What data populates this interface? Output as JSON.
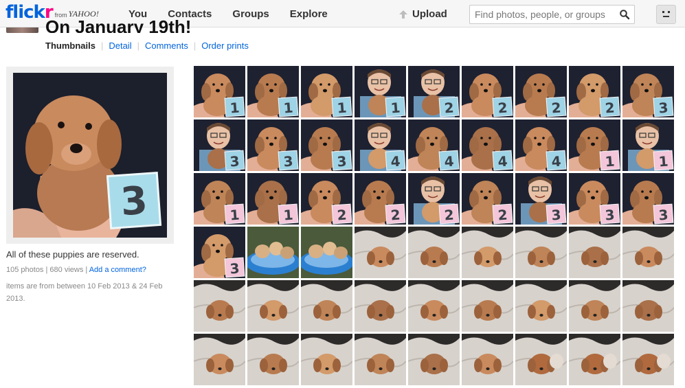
{
  "nav": {
    "logo_part1": "flick",
    "logo_part2": "r",
    "from_label": "from",
    "yahoo_label": "YAHOO!",
    "links": [
      "You",
      "Contacts",
      "Groups",
      "Explore"
    ],
    "upload_label": "Upload",
    "search_placeholder": "Find photos, people, or groups"
  },
  "set": {
    "title": "On January 19th!",
    "tabs": [
      "Thumbnails",
      "Detail",
      "Comments",
      "Order prints"
    ],
    "active_tab": "Thumbnails",
    "description": "All of these puppies are reserved.",
    "photo_count": "105 photos",
    "views": "680 views",
    "comment_link": "Add a comment?",
    "date_range": "items are from between 10 Feb 2013 & 24 Feb 2013.",
    "cover_card_number": "3"
  },
  "grid": {
    "rows": [
      [
        {
          "scene": "hand",
          "card": "1",
          "cardColor": "#9fd3e6"
        },
        {
          "scene": "hand",
          "card": "1",
          "cardColor": "#9fd3e6"
        },
        {
          "scene": "hand",
          "card": "1",
          "cardColor": "#9fd3e6"
        },
        {
          "scene": "boy",
          "card": "1",
          "cardColor": "#9fd3e6"
        },
        {
          "scene": "boy",
          "card": "2",
          "cardColor": "#9fd3e6"
        },
        {
          "scene": "hand",
          "card": "2",
          "cardColor": "#9fd3e6"
        },
        {
          "scene": "hand",
          "card": "2",
          "cardColor": "#9fd3e6"
        },
        {
          "scene": "hand",
          "card": "2",
          "cardColor": "#9fd3e6"
        },
        {
          "scene": "hand",
          "card": "3",
          "cardColor": "#9fd3e6"
        }
      ],
      [
        {
          "scene": "boy",
          "card": "3",
          "cardColor": "#9fd3e6"
        },
        {
          "scene": "hand",
          "card": "3",
          "cardColor": "#9fd3e6"
        },
        {
          "scene": "hand",
          "card": "3",
          "cardColor": "#9fd3e6"
        },
        {
          "scene": "boy",
          "card": "4",
          "cardColor": "#9fd3e6"
        },
        {
          "scene": "hand",
          "card": "4",
          "cardColor": "#9fd3e6"
        },
        {
          "scene": "hand",
          "card": "4",
          "cardColor": "#9fd3e6"
        },
        {
          "scene": "hand",
          "card": "4",
          "cardColor": "#9fd3e6"
        },
        {
          "scene": "hand",
          "card": "1",
          "cardColor": "#f3c6da"
        },
        {
          "scene": "boy",
          "card": "1",
          "cardColor": "#f3c6da"
        }
      ],
      [
        {
          "scene": "hand",
          "card": "1",
          "cardColor": "#f3c6da"
        },
        {
          "scene": "hand",
          "card": "1",
          "cardColor": "#f3c6da"
        },
        {
          "scene": "hand",
          "card": "2",
          "cardColor": "#f3c6da"
        },
        {
          "scene": "hand",
          "card": "2",
          "cardColor": "#f3c6da"
        },
        {
          "scene": "boy",
          "card": "2",
          "cardColor": "#f3c6da"
        },
        {
          "scene": "hand",
          "card": "2",
          "cardColor": "#f3c6da"
        },
        {
          "scene": "boy",
          "card": "3",
          "cardColor": "#f3c6da"
        },
        {
          "scene": "hand",
          "card": "3",
          "cardColor": "#f3c6da"
        },
        {
          "scene": "hand",
          "card": "3",
          "cardColor": "#f3c6da"
        }
      ],
      [
        {
          "scene": "hand",
          "card": "3",
          "cardColor": "#f3c6da"
        },
        {
          "scene": "pool",
          "card": "",
          "cardColor": ""
        },
        {
          "scene": "pool",
          "card": "",
          "cardColor": ""
        },
        {
          "scene": "blanket",
          "card": "",
          "cardColor": ""
        },
        {
          "scene": "blanket",
          "card": "",
          "cardColor": ""
        },
        {
          "scene": "blanket",
          "card": "",
          "cardColor": ""
        },
        {
          "scene": "blanket",
          "card": "",
          "cardColor": ""
        },
        {
          "scene": "blanket",
          "card": "",
          "cardColor": ""
        },
        {
          "scene": "blanket",
          "card": "",
          "cardColor": ""
        }
      ],
      [
        {
          "scene": "blanket",
          "card": "",
          "cardColor": ""
        },
        {
          "scene": "blanket",
          "card": "",
          "cardColor": ""
        },
        {
          "scene": "blanket",
          "card": "",
          "cardColor": ""
        },
        {
          "scene": "blanket",
          "card": "",
          "cardColor": ""
        },
        {
          "scene": "blanket",
          "card": "",
          "cardColor": ""
        },
        {
          "scene": "blanket",
          "card": "",
          "cardColor": ""
        },
        {
          "scene": "blanket",
          "card": "",
          "cardColor": ""
        },
        {
          "scene": "blanket",
          "card": "",
          "cardColor": ""
        },
        {
          "scene": "blanket",
          "card": "",
          "cardColor": ""
        }
      ],
      [
        {
          "scene": "blanket",
          "card": "",
          "cardColor": ""
        },
        {
          "scene": "blanket",
          "card": "",
          "cardColor": ""
        },
        {
          "scene": "blanket",
          "card": "",
          "cardColor": ""
        },
        {
          "scene": "blanket",
          "card": "",
          "cardColor": ""
        },
        {
          "scene": "blanket",
          "card": "",
          "cardColor": ""
        },
        {
          "scene": "blanket",
          "card": "",
          "cardColor": ""
        },
        {
          "scene": "blanket2",
          "card": "",
          "cardColor": ""
        },
        {
          "scene": "blanket2",
          "card": "",
          "cardColor": ""
        },
        {
          "scene": "blanket2",
          "card": "",
          "cardColor": ""
        }
      ]
    ]
  }
}
